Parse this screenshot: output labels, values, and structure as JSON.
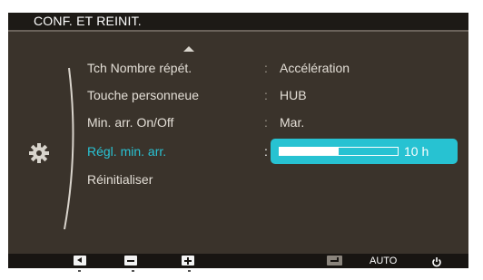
{
  "osd": {
    "title": "CONF. ET REINIT.",
    "menu": [
      {
        "label": "Tch Nombre répét.",
        "colon": ":",
        "value": "Accélération"
      },
      {
        "label": "Touche personneue",
        "colon": ":",
        "value": "HUB"
      },
      {
        "label": "Min. arr. On/Off",
        "colon": ":",
        "value": "Mar."
      },
      {
        "label": "Régl. min. arr.",
        "colon": ":",
        "value": "10 h",
        "progress_fraction": 0.5
      },
      {
        "label": "Réinitialiser"
      }
    ],
    "selected_index": 3,
    "icons": {
      "category": "gear-icon",
      "scroll_up": "arrow-up-icon"
    }
  },
  "controls": {
    "auto_label": "AUTO",
    "buttons": [
      "left-arrow-icon",
      "minus-icon",
      "plus-icon",
      "enter-icon",
      "auto",
      "power-icon"
    ]
  },
  "colors": {
    "accent": "#27c2d2",
    "background": "#3a332b",
    "title_bar": "#1d1a16",
    "text": "#e3ded6"
  }
}
